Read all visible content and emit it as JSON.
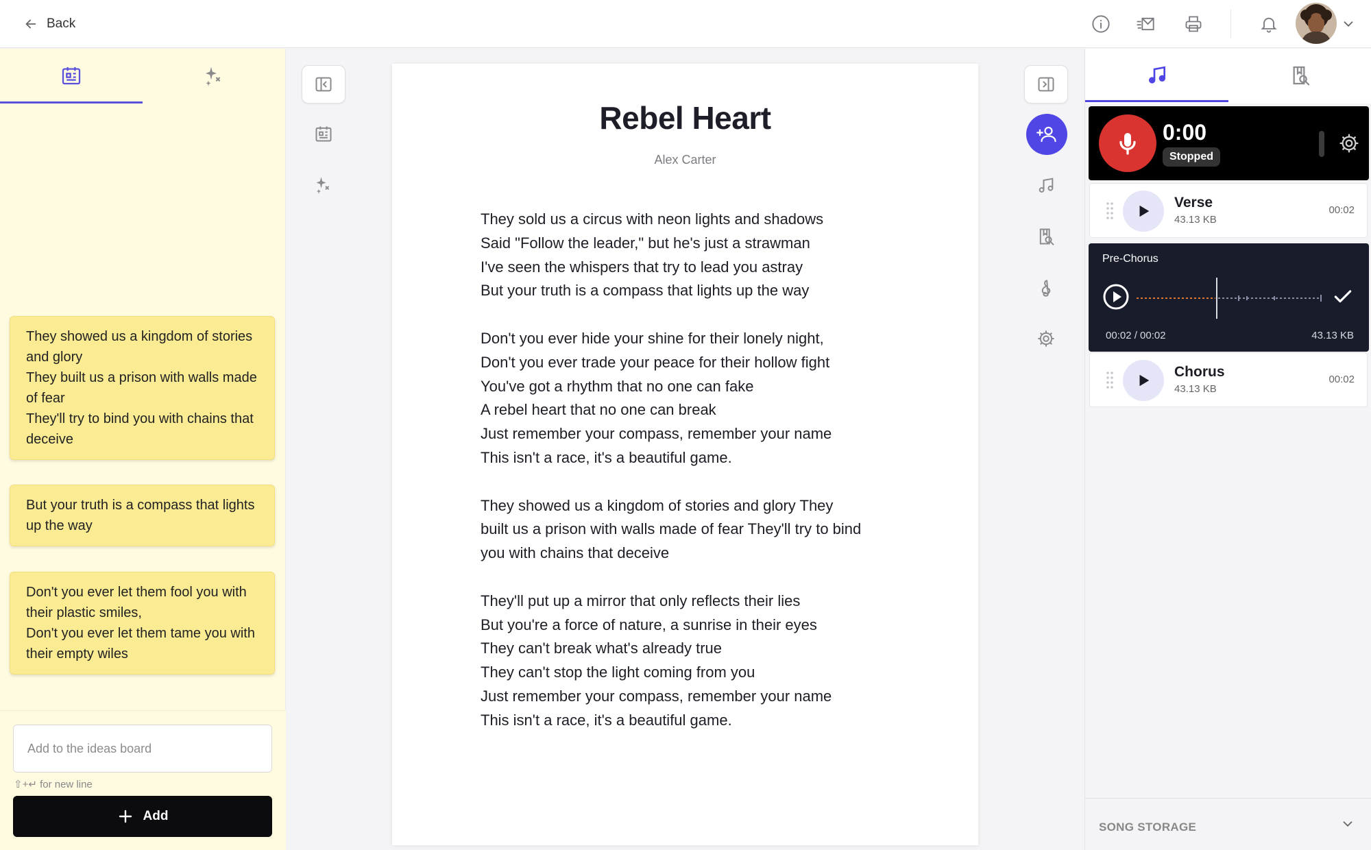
{
  "topbar": {
    "back_label": "Back",
    "icons": [
      "info-icon",
      "mail-icon",
      "print-icon",
      "bell-icon"
    ],
    "caret_icon": "chevron-down-icon"
  },
  "left_panel": {
    "tabs": [
      {
        "icon": "board-icon",
        "active": true
      },
      {
        "icon": "sparkles-icon",
        "active": false
      }
    ],
    "notes": [
      "They showed us a kingdom of stories and glory\nThey built us a prison with walls made of fear\nThey'll try to bind you with chains that deceive",
      "But your truth is a compass that lights up the way",
      "Don't you ever let them fool you with their plastic smiles,\nDon't you ever let them tame you with their empty wiles"
    ],
    "input_placeholder": "Add to the ideas board",
    "hint": "⇧+↵ for new line",
    "add_label": "Add"
  },
  "document": {
    "title": "Rebel Heart",
    "author": "Alex Carter",
    "stanzas": [
      [
        "They sold us a circus with neon lights and shadows",
        "Said \"Follow the leader,\" but he's just a strawman",
        "I've seen the whispers that try to lead you astray",
        "But your truth is a compass that lights up the way"
      ],
      [
        "Don't you ever hide your shine for their lonely night,",
        "Don't you ever trade your peace for their hollow fight",
        "You've got a rhythm that no one can fake",
        "A rebel heart that no one can break",
        "Just remember your compass, remember your name",
        "This isn't a race, it's a beautiful game."
      ],
      [
        "They showed us a kingdom of stories and glory They",
        "built us a prison with walls made of fear They'll try to bind",
        "you with chains that deceive"
      ],
      [
        "They'll put up a mirror that only reflects their lies",
        "But you're a force of nature, a sunrise in their eyes",
        "They can't break what's already true",
        "They can't stop the light coming from you",
        "Just remember your compass, remember your name",
        "This isn't a race, it's a beautiful game."
      ]
    ]
  },
  "recorder": {
    "time": "0:00",
    "status": "Stopped",
    "accent": "#d93430"
  },
  "takes": [
    {
      "name": "Verse",
      "size": "43.13 KB",
      "duration": "00:02"
    },
    {
      "name": "Pre-Chorus",
      "progress": "00:02 / 00:02",
      "size": "43.13 KB"
    },
    {
      "name": "Chorus",
      "size": "43.13 KB",
      "duration": "00:02"
    }
  ],
  "storage": {
    "label": "SONG STORAGE"
  },
  "colors": {
    "accent": "#4f46e5",
    "note_bg": "#fbec94",
    "sidebar_bg": "#fffbe1"
  }
}
